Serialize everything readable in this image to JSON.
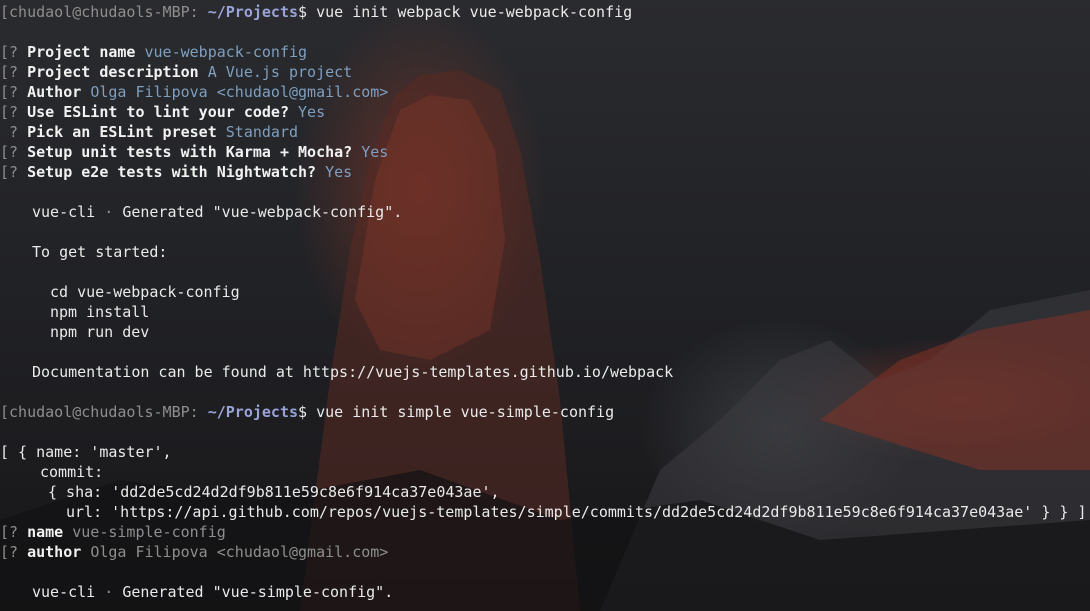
{
  "prompt": {
    "user_host": "[chudaol@chudaols-MBP:",
    "path": "~/Projects",
    "symbol": "$"
  },
  "commands": {
    "webpack": "vue init webpack vue-webpack-config",
    "simple": "vue init simple vue-simple-config"
  },
  "questions": [
    {
      "marker": "[?",
      "label": "Project name",
      "answer": "vue-webpack-config"
    },
    {
      "marker": "[?",
      "label": "Project description",
      "answer": "A Vue.js project"
    },
    {
      "marker": "[?",
      "label": "Author",
      "answer": "Olga Filipova <chudaol@gmail.com>"
    },
    {
      "marker": "[?",
      "label": "Use ESLint to lint your code?",
      "answer": "Yes"
    },
    {
      "marker": "?",
      "label": "Pick an ESLint preset",
      "answer": "Standard"
    },
    {
      "marker": "[?",
      "label": "Setup unit tests with Karma + Mocha?",
      "answer": "Yes"
    },
    {
      "marker": "[?",
      "label": "Setup e2e tests with Nightwatch?",
      "answer": "Yes"
    }
  ],
  "webpack_output": {
    "generated_prefix": "vue-cli",
    "separator": "·",
    "generated": "Generated \"vue-webpack-config\".",
    "get_started": "To get started:",
    "steps": [
      "cd vue-webpack-config",
      "npm install",
      "npm run dev"
    ],
    "docs": "Documentation can be found at https://vuejs-templates.github.io/webpack"
  },
  "branches_output": {
    "line1": "[ { name: 'master',",
    "line2": "commit:",
    "line3": "{ sha: 'dd2de5cd24d2df9b811e59c8e6f914ca37e043ae',",
    "line4": "url: 'https://api.github.com/repos/vuejs-templates/simple/commits/dd2de5cd24d2df9b811e59c8e6f914ca37e043ae' } } ]"
  },
  "simple_questions": [
    {
      "marker": "[?",
      "label": "name",
      "answer": "vue-simple-config"
    },
    {
      "marker": "[?",
      "label": "author",
      "answer": "Olga Filipova <chudaol@gmail.com>"
    }
  ],
  "simple_output": {
    "generated_prefix": "vue-cli",
    "separator": "·",
    "generated": "Generated \"vue-simple-config\"."
  }
}
